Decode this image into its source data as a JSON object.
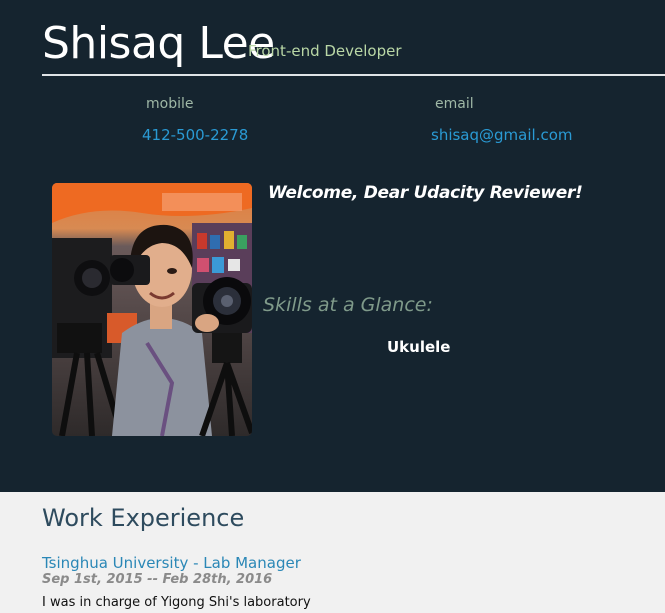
{
  "header": {
    "name": "Shisaq Lee",
    "role": "Front-end Developer"
  },
  "contacts": {
    "mobile_label": "mobile",
    "mobile_value": "412-500-2278",
    "email_label": "email",
    "email_value": "shisaq@gmail.com"
  },
  "bio": {
    "welcome": "Welcome, Dear Udacity Reviewer!",
    "skills_title": "Skills at a Glance:",
    "skills": [
      "Ukulele"
    ]
  },
  "work": {
    "title": "Work Experience",
    "jobs": [
      {
        "title": "Tsinghua University - Lab Manager",
        "dates": "Sep 1st, 2015 -- Feb 28th, 2016",
        "description": "I was in charge of Yigong Shi's laboratory"
      }
    ]
  },
  "colors": {
    "header_bg": "#15242f",
    "page_bg": "#f1f1f1",
    "link": "#2a9ad4",
    "role": "#b9d7a6",
    "work_heading": "#2e4b5e"
  }
}
